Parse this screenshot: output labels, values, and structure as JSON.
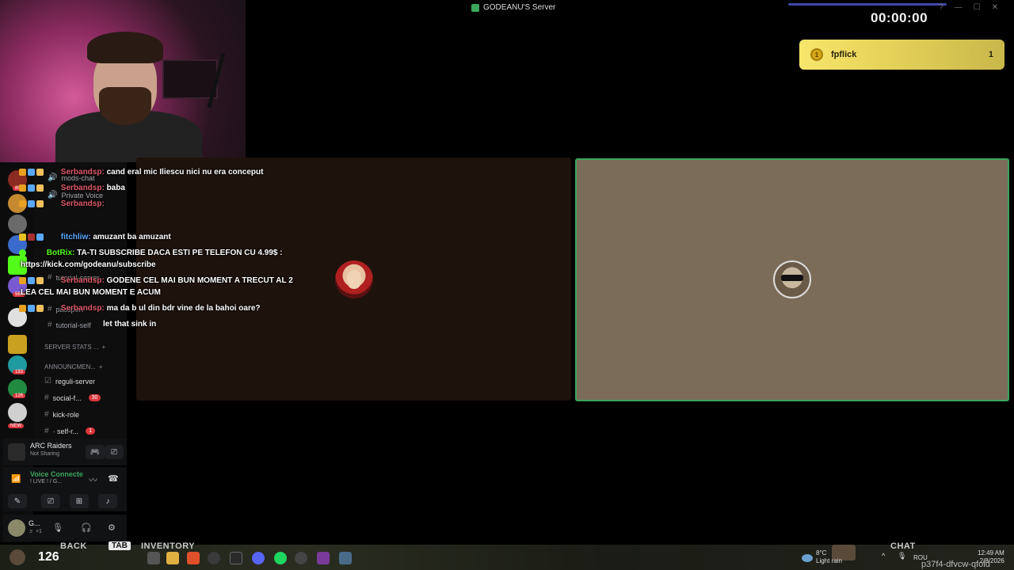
{
  "window": {
    "title": "GODEANU'S Server",
    "controls": [
      "?",
      "—",
      "☐",
      "✕"
    ]
  },
  "timer": "00:00:00",
  "leaderboard": {
    "name": "fpflick",
    "score": "1"
  },
  "chat": [
    {
      "user": "Serbandsp:",
      "text": "cand eral mic Iliescu nici nu era conceput",
      "color": "red"
    },
    {
      "user": "Serbandsp:",
      "text": "baba",
      "color": "red"
    },
    {
      "user": "Serbandsp:",
      "text": "",
      "color": "red"
    },
    {
      "user": "fitchliw:",
      "text": "amuzant ba amuzant",
      "color": "blue"
    },
    {
      "user": "BotRix:",
      "text": "TA-TI SUBSCRIBE DACA ESTI PE TELEFON CU 4.99$ :",
      "color": "green"
    },
    {
      "user": "",
      "text": "https://kick.com/godeanu/subscribe",
      "color": ""
    },
    {
      "user": "Serbandsp:",
      "text": "GODENE CEL MAI BUN MOMENT A TRECUT AL 2",
      "color": "red"
    },
    {
      "user": "",
      "text": "LEA CEL MAI BUN MOMENT E ACUM",
      "color": ""
    },
    {
      "user": "Serbandsp:",
      "text": "ma da b ul din bdr vine de la bahoi oare?",
      "color": "red"
    },
    {
      "user": "",
      "text": "let that sink in",
      "color": ""
    }
  ],
  "channels": {
    "items": [
      {
        "name": "mods-chat",
        "icon": "🔊"
      },
      {
        "name": "Private Voice",
        "icon": "🔊"
      },
      {
        "name": "tutorial-server",
        "icon": "#"
      },
      {
        "name": "passport",
        "icon": "#"
      },
      {
        "name": "tutorial-self",
        "icon": "#"
      }
    ],
    "categories": [
      {
        "name": "SERVER STATS ..."
      },
      {
        "name": "ANNOUNCMEN..."
      }
    ],
    "bottom": [
      {
        "name": "reguli-server",
        "badge": ""
      },
      {
        "name": "social-f...",
        "badge": "30"
      },
      {
        "name": "kick-role",
        "badge": ""
      },
      {
        "name": "· self-r...",
        "badge": "1"
      }
    ]
  },
  "rail_badges": [
    "80",
    "193",
    "126",
    "568",
    "NEW"
  ],
  "activity": {
    "game": "ARC Raiders",
    "status": "Not Sharing"
  },
  "voice": {
    "status": "Voice Connecte",
    "channel": "! LIVE ! / G..."
  },
  "user": {
    "name": "G...",
    "sub": "♬ +1"
  },
  "taskbar": {
    "kick_count": "126",
    "back_label": "BACK",
    "tab_key": "TAB",
    "inventory_label": "INVENTORY",
    "chat_label": "CHAT",
    "weather_temp": "8°C",
    "weather_desc": "Light rain",
    "lang": "ROU",
    "time": "12:49 AM",
    "date": "2/8/2026",
    "watermark": "p37f4-dfvcw-qfold"
  }
}
